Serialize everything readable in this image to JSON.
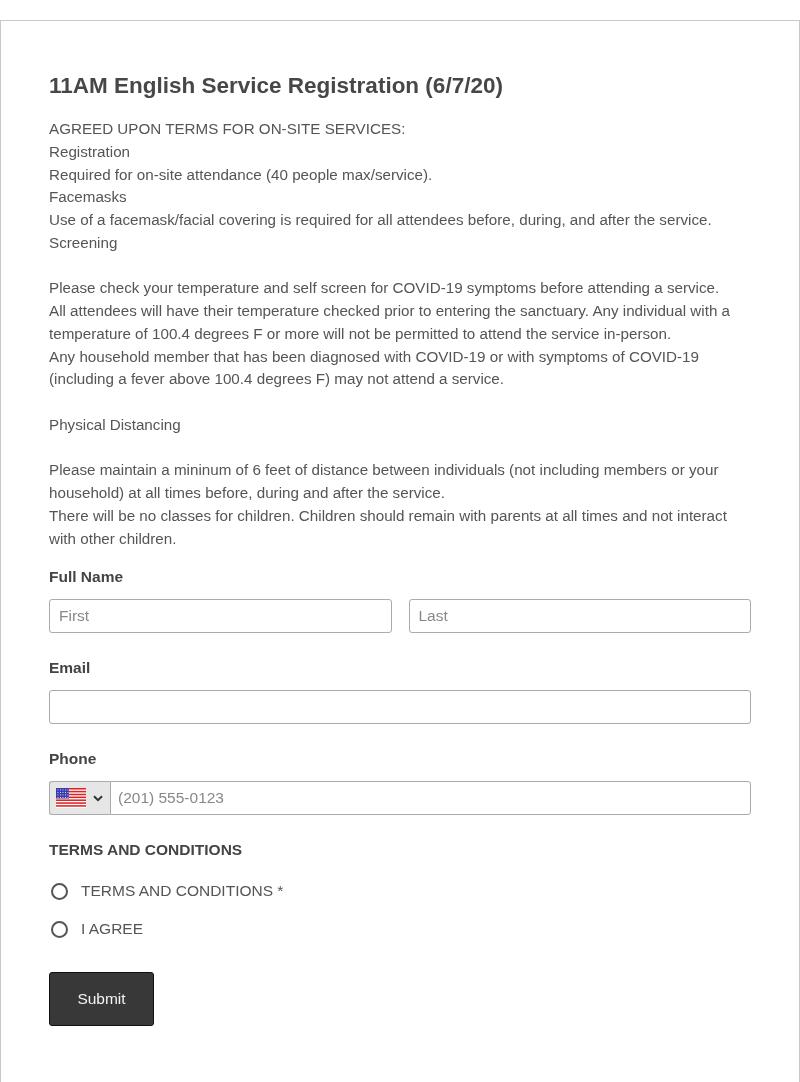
{
  "form": {
    "title": "11AM English Service Registration (6/7/20)",
    "notice": [
      {
        "paragraphs": [
          "AGREED UPON TERMS FOR ON-SITE SERVICES:",
          "Registration",
          "Required for on-site attendance (40 people max/service).",
          "Facemasks",
          "Use of a facemask/facial covering is required for all attendees before, during, and after the service.",
          "Screening"
        ]
      },
      {
        "paragraphs": [
          "Please check your temperature and self screen for COVID-19 symptoms before attending a service.",
          "All attendees will have their temperature checked prior to entering the sanctuary. Any individual with a temperature of 100.4 degrees F or more will not be permitted to attend the service in-person.",
          "Any household member that has been diagnosed with COVID-19 or with symptoms of COVID-19 (including a fever above 100.4 degrees F) may not attend a service."
        ]
      },
      {
        "paragraphs": [
          "Physical Distancing"
        ]
      },
      {
        "paragraphs": [
          "Please maintain a mininum of 6 feet of distance between individuals (not including members or your household) at all times before, during and after the service.",
          "There will be no classes for children. Children should remain with parents at all times and not interact with other children."
        ]
      }
    ],
    "fields": [
      {
        "kind": "name",
        "label": "Full Name",
        "placeholders": [
          "First",
          "Last"
        ]
      },
      {
        "kind": "email",
        "label": "Email"
      },
      {
        "kind": "phone",
        "label": "Phone",
        "placeholder": "(201) 555-0123"
      },
      {
        "kind": "radio",
        "label": "TERMS AND CONDITIONS",
        "options": [
          {
            "label": "TERMS AND CONDITIONS *",
            "selected": false
          },
          {
            "label": "I AGREE",
            "selected": false
          }
        ]
      }
    ],
    "submit": "Submit"
  }
}
